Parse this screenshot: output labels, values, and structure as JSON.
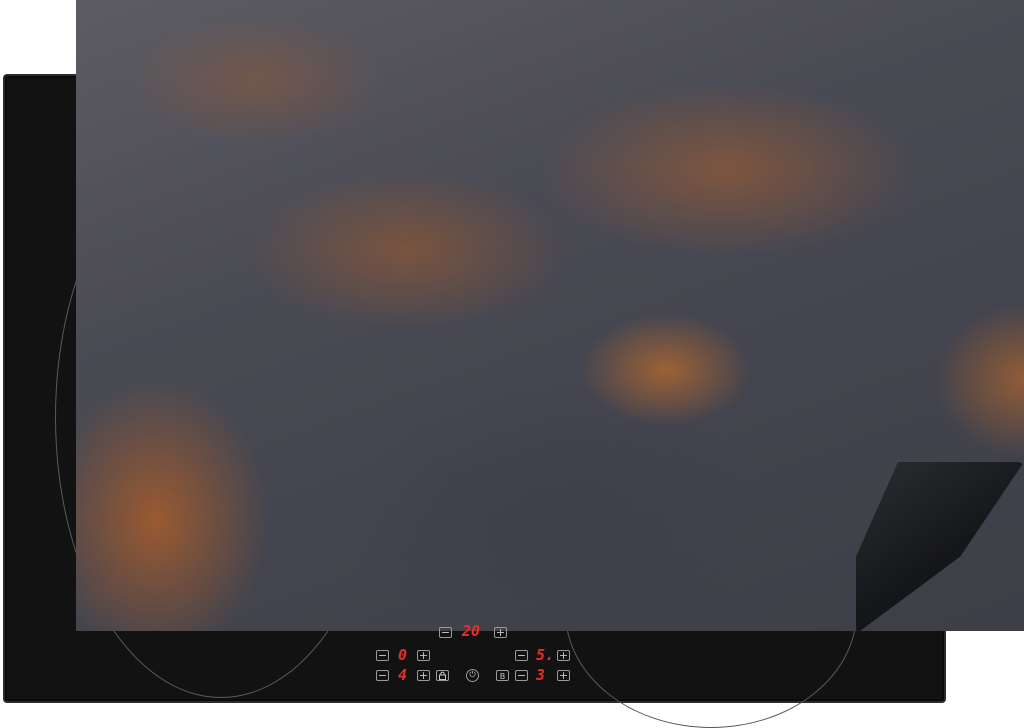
{
  "controls": {
    "minus": "−",
    "plus": "+",
    "top_timer": "20",
    "zone_top_left": "0",
    "zone_top_right": "5.",
    "zone_bottom_left": "4",
    "zone_bottom_right": "3",
    "boost_label": "B"
  },
  "icons": [
    "minus-icon",
    "plus-icon",
    "lock-icon",
    "power-icon",
    "boost-icon"
  ],
  "colors": {
    "cooktop": "#121212",
    "display_digits": "#e3302a",
    "rust": "#c0662a",
    "metal_gray": "#4b4b54"
  }
}
